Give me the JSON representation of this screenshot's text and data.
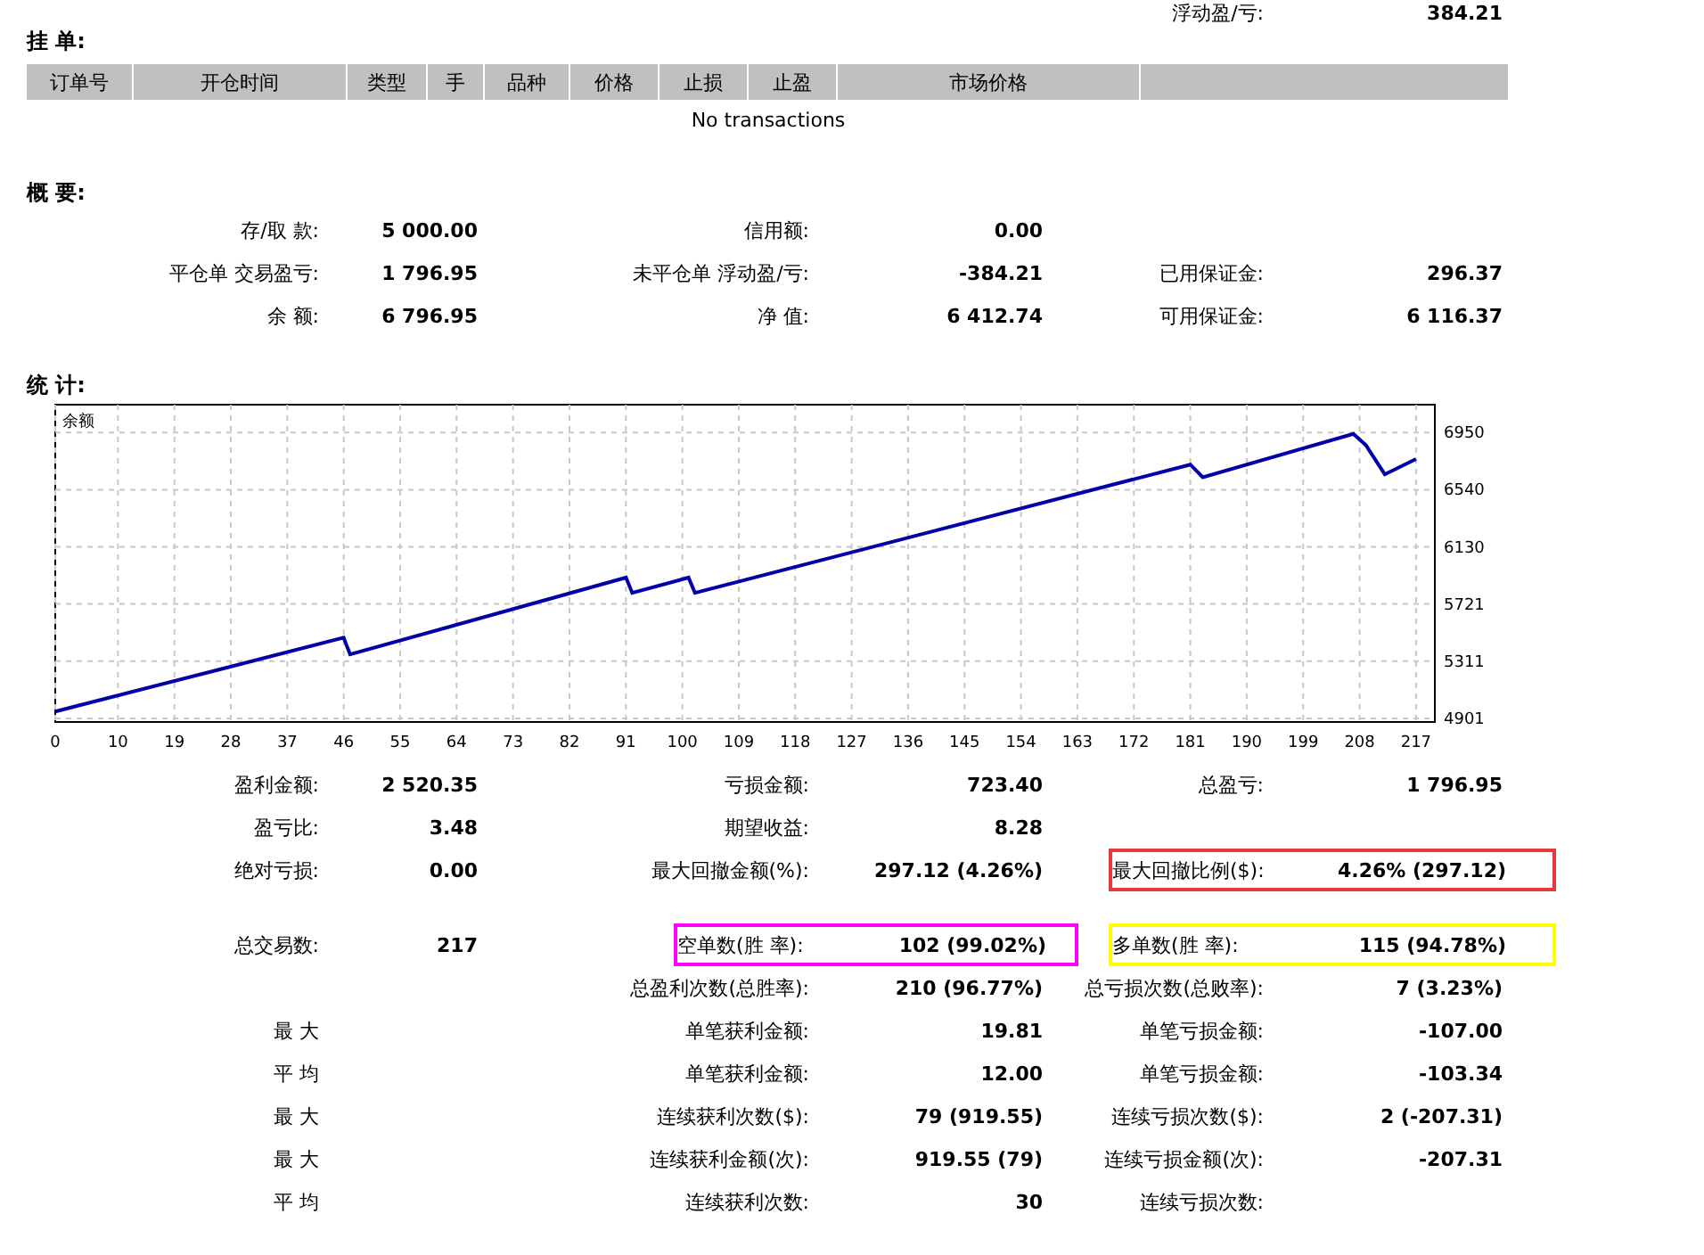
{
  "top_row": {
    "label": "浮动盈/亏:",
    "value": "384.21"
  },
  "orders": {
    "title": "挂 单:",
    "columns": [
      "订单号",
      "开仓时间",
      "类型",
      "手",
      "品种",
      "价格",
      "止损",
      "止盈",
      "市场价格",
      ""
    ],
    "empty_text": "No transactions"
  },
  "summary": {
    "title": "概 要:",
    "rows": [
      {
        "col_1": {
          "label": "存/取 款:",
          "value": "5 000.00"
        },
        "col_2": {
          "label": "信用额:",
          "value": "0.00"
        }
      },
      {
        "col_1": {
          "label": "平仓单 交易盈亏:",
          "value": "1 796.95"
        },
        "col_2": {
          "label": "未平仓单 浮动盈/亏:",
          "value": "-384.21"
        },
        "col_3": {
          "label": "已用保证金:",
          "value": "296.37"
        }
      },
      {
        "col_1": {
          "label": "余 额:",
          "value": "6 796.95"
        },
        "col_2": {
          "label": "净 值:",
          "value": "6 412.74"
        },
        "col_3": {
          "label": "可用保证金:",
          "value": "6 116.37"
        }
      }
    ]
  },
  "stats": {
    "title": "统 计:",
    "chart_data": {
      "type": "line",
      "grid": true,
      "x": [
        0,
        46,
        47,
        91,
        92,
        101,
        102,
        181,
        183,
        207,
        209,
        212,
        217
      ],
      "series": [
        {
          "name": "余额",
          "color": "#0000a8",
          "values": [
            4950,
            5480,
            5360,
            5910,
            5800,
            5910,
            5800,
            6720,
            6630,
            6940,
            6860,
            6650,
            6760
          ]
        }
      ],
      "xlim": [
        0,
        220
      ],
      "ylim": [
        4875,
        7150
      ],
      "xticks": [
        0,
        10,
        19,
        28,
        37,
        46,
        55,
        64,
        73,
        82,
        91,
        100,
        109,
        118,
        127,
        136,
        145,
        154,
        163,
        172,
        181,
        190,
        199,
        208,
        217
      ],
      "yticks": [
        4901,
        5311,
        5721,
        6130,
        6540,
        6950
      ]
    },
    "rows": [
      {
        "col_1": {
          "label": "盈利金额:",
          "value": "2 520.35"
        },
        "col_2": {
          "label": "亏损金额:",
          "value": "723.40"
        },
        "col_3": {
          "label": "总盈亏:",
          "value": "1 796.95"
        }
      },
      {
        "col_1": {
          "label": "盈亏比:",
          "value": "3.48"
        },
        "col_2": {
          "label": "期望收益:",
          "value": "8.28"
        }
      },
      {
        "col_1": {
          "label": "绝对亏损:",
          "value": "0.00"
        },
        "col_2": {
          "label": "最大回撤金额(%):",
          "value": "297.12 (4.26%)"
        },
        "col_3": {
          "label": "最大回撤比例($):",
          "value": "4.26% (297.12)",
          "color": "#e8383d"
        }
      }
    ],
    "more_rows": [
      {
        "col_1": {
          "label": "总交易数:",
          "value": "217"
        },
        "col_2": {
          "label": "空单数(胜 率):",
          "value": "102 (99.02%)",
          "color": "#ff00ff"
        },
        "col_3": {
          "label": "多单数(胜 率):",
          "value": "115 (94.78%)",
          "color": "#ffff00"
        }
      },
      {
        "col_2": {
          "label": "总盈利次数(总胜率):",
          "value": "210 (96.77%)"
        },
        "col_3": {
          "label": "总亏损次数(总败率):",
          "value": "7 (3.23%)"
        }
      },
      {
        "col_1": {
          "label": "最 大"
        },
        "col_2": {
          "label": "单笔获利金额:",
          "value": "19.81"
        },
        "col_3": {
          "label": "单笔亏损金额:",
          "value": "-107.00"
        }
      },
      {
        "col_1": {
          "label": "平 均"
        },
        "col_2": {
          "label": "单笔获利金额:",
          "value": "12.00"
        },
        "col_3": {
          "label": "单笔亏损金额:",
          "value": "-103.34"
        }
      },
      {
        "col_1": {
          "label": "最 大"
        },
        "col_2": {
          "label": "连续获利次数($):",
          "value": "79 (919.55)"
        },
        "col_3": {
          "label": "连续亏损次数($):",
          "value": "2 (-207.31)"
        }
      },
      {
        "col_1": {
          "label": "最 大"
        },
        "col_2": {
          "label": "连续获利金额(次):",
          "value": "919.55 (79)"
        },
        "col_3": {
          "label": "连续亏损金额(次):",
          "value": "-207.31"
        }
      },
      {
        "col_1": {
          "label": "平 均"
        },
        "col_2": {
          "label": "连续获利次数:",
          "value": "30"
        },
        "col_3": {
          "label": "连续亏损次数:"
        }
      }
    ]
  }
}
